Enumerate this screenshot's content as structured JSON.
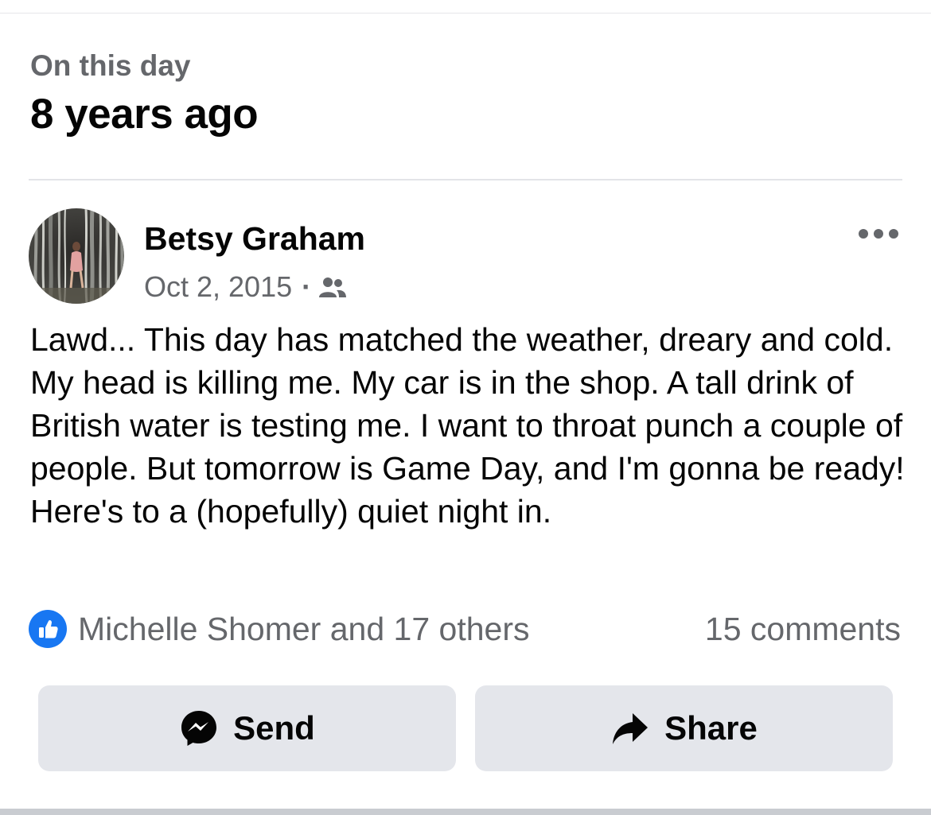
{
  "memory": {
    "subtitle": "On this day",
    "title": "8 years ago"
  },
  "post": {
    "author": "Betsy Graham",
    "date": "Oct 2, 2015",
    "separator": "·",
    "audience_icon": "friends-icon",
    "body": "Lawd... This day has matched the weather, dreary and cold. My head is killing me. My car is in the shop. A tall drink of British water is testing me. I want to throat punch a couple of people. But tomorrow is Game Day, and I'm gonna be ready! Here's to a (hopefully) quiet night in.",
    "more_icon": "more-options-icon"
  },
  "engagement": {
    "reaction_icon": "like-icon",
    "reactions_text": "Michelle Shomer and 17 others",
    "comments_text": "15 comments"
  },
  "actions": {
    "send_label": "Send",
    "send_icon": "messenger-icon",
    "share_label": "Share",
    "share_icon": "share-arrow-icon"
  },
  "colors": {
    "like_blue": "#1877f2",
    "secondary_text": "#65676b",
    "button_bg": "#e4e6eb"
  }
}
